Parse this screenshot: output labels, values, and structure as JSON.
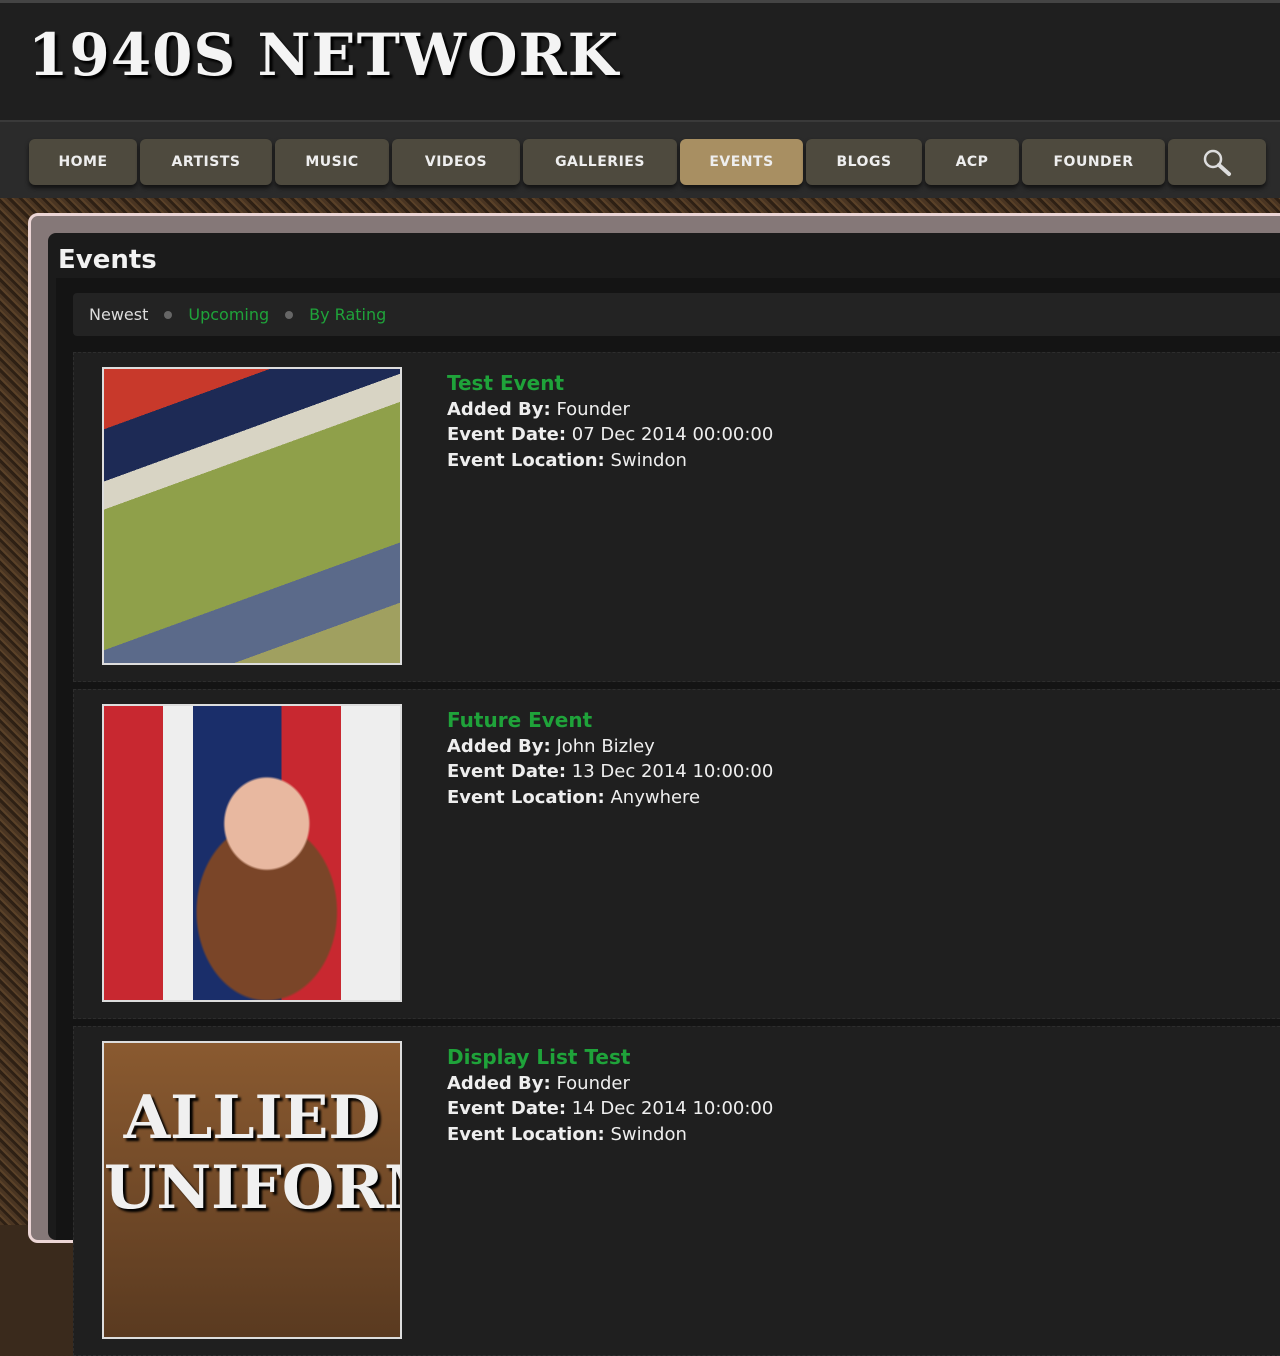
{
  "site": {
    "logo": "1940S NETWORK"
  },
  "nav": [
    {
      "label": "HOME"
    },
    {
      "label": "ARTISTS"
    },
    {
      "label": "MUSIC"
    },
    {
      "label": "VIDEOS"
    },
    {
      "label": "GALLERIES"
    },
    {
      "label": "EVENTS",
      "active": true
    },
    {
      "label": "BLOGS"
    },
    {
      "label": "ACP"
    },
    {
      "label": "FOUNDER"
    }
  ],
  "page": {
    "title": "Events"
  },
  "filters": [
    {
      "label": "Newest"
    },
    {
      "label": "Upcoming"
    },
    {
      "label": "By Rating"
    }
  ],
  "labels": {
    "added_by": "Added By:",
    "event_date": "Event Date:",
    "event_location": "Event Location:"
  },
  "events": [
    {
      "name": "Test Event",
      "added_by": "Founder",
      "date": "07 Dec 2014 00:00:00",
      "location": "Swindon"
    },
    {
      "name": "Future Event",
      "added_by": "John Bizley",
      "date": "13 Dec 2014 10:00:00",
      "location": "Anywhere"
    },
    {
      "name": "Display List Test",
      "added_by": "Founder",
      "date": "14 Dec 2014 10:00:00",
      "location": "Swindon",
      "image_text": "ALLIED UNIFORMS"
    }
  ],
  "colors": {
    "accent": "#1fa33a",
    "active_nav": "#a88f62",
    "nav": "#4e4a3e"
  }
}
